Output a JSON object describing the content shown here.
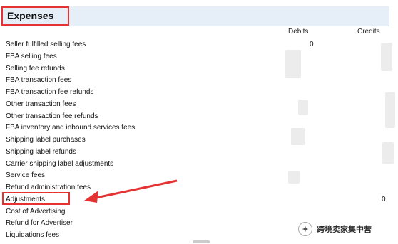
{
  "section": {
    "title": "Expenses"
  },
  "columns": {
    "debits": "Debits",
    "credits": "Credits"
  },
  "rows": [
    {
      "label": "Seller fulfilled selling fees",
      "debit": "0",
      "credit": ""
    },
    {
      "label": "FBA selling fees",
      "debit": "",
      "credit": ""
    },
    {
      "label": "Selling fee refunds",
      "debit": "",
      "credit": ""
    },
    {
      "label": "FBA transaction fees",
      "debit": "",
      "credit": ""
    },
    {
      "label": "FBA transaction fee refunds",
      "debit": "",
      "credit": ""
    },
    {
      "label": "Other transaction fees",
      "debit": "",
      "credit": ""
    },
    {
      "label": "Other transaction fee refunds",
      "debit": "",
      "credit": ""
    },
    {
      "label": "FBA inventory and inbound services fees",
      "debit": "",
      "credit": ""
    },
    {
      "label": "Shipping label purchases",
      "debit": "",
      "credit": ""
    },
    {
      "label": "Shipping label refunds",
      "debit": "",
      "credit": ""
    },
    {
      "label": "Carrier shipping label adjustments",
      "debit": "",
      "credit": ""
    },
    {
      "label": "Service fees",
      "debit": "",
      "credit": ""
    },
    {
      "label": "Refund administration fees",
      "debit": "",
      "credit": ""
    },
    {
      "label": "Adjustments",
      "debit": "",
      "credit": "0"
    },
    {
      "label": "Cost of Advertising",
      "debit": "",
      "credit": ""
    },
    {
      "label": "Refund for Advertiser",
      "debit": "",
      "credit": ""
    },
    {
      "label": "Liquidations fees",
      "debit": "",
      "credit": ""
    }
  ],
  "watermark": {
    "text": "跨境卖家集中营"
  },
  "colors": {
    "annotation_red": "#e53333",
    "header_band": "#e6eef8"
  }
}
